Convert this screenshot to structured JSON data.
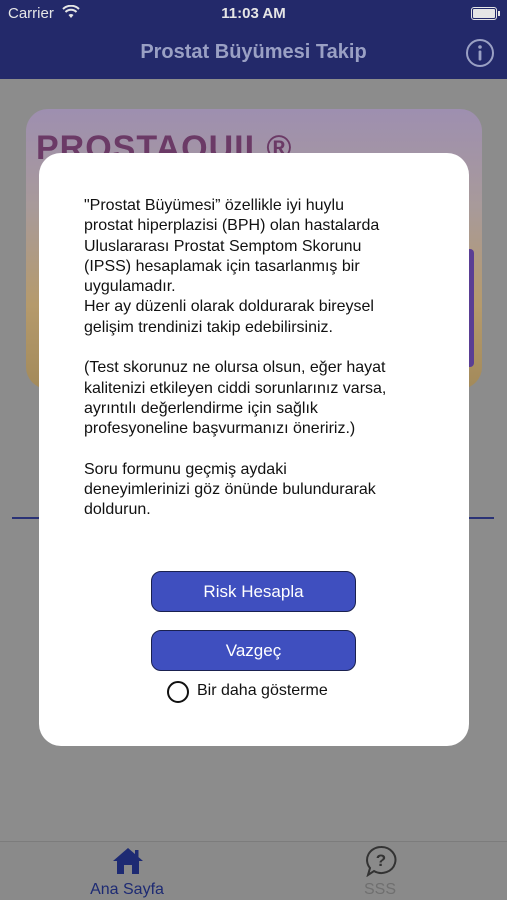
{
  "status_bar": {
    "carrier": "Carrier",
    "time": "11:03 AM",
    "wifi_icon": "wifi-icon",
    "battery_icon": "battery-icon"
  },
  "nav_bar": {
    "title": "Prostat Büyümesi Takip",
    "info_icon": "info-circle-icon"
  },
  "banner": {
    "logo_text": "PROSTAQUIL®"
  },
  "modal": {
    "message": "\"Prostat Büyümesi” özellikle iyi huylu\nprostat hiperplazisi (BPH) olan hastalarda\nUluslararası Prostat Semptom Skorunu\n(IPSS) hesaplamak için tasarlanmış bir\nuygulamadır.\nHer ay düzenli olarak doldurarak bireysel\ngelişim trendinizi takip edebilirsiniz.\n\n(Test skorunuz ne olursa olsun, eğer hayat\nkalitenizi etkileyen ciddi sorunlarınız varsa,\nayrıntılı değerlendirme için sağlık\nprofesyoneline başvurmanızı öneririz.)\n\nSoru formunu geçmiş aydaki\ndeneyimlerinizi göz önünde bulundurarak\ndoldurun.",
    "risk_button": "Risk Hesapla",
    "cancel_button": "Vazgeç",
    "dont_show_label": "Bir daha gösterme"
  },
  "tab_bar": {
    "tabs": [
      {
        "label": "Ana Sayfa",
        "icon": "home-icon",
        "selected": true
      },
      {
        "label": "SSS",
        "icon": "question-bubble-icon",
        "selected": false
      }
    ]
  },
  "colors": {
    "nav_background": "#23296a",
    "button_fill": "#3f4fbf",
    "dim_overlay": "#8c8c8c",
    "tab_selected": "#1d2a73"
  }
}
